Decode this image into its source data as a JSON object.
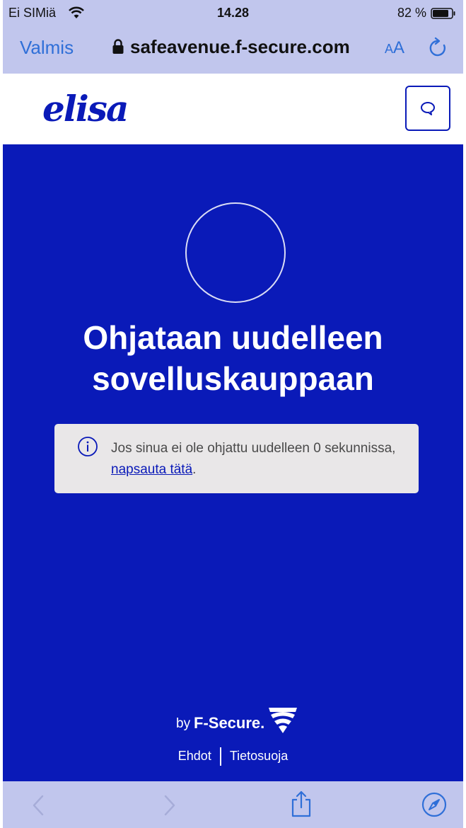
{
  "status_bar": {
    "carrier": "Ei SIMiä",
    "time": "14.28",
    "battery": "82 %"
  },
  "browser": {
    "done_label": "Valmis",
    "url": "safeavenue.f-secure.com",
    "text_size_small": "A",
    "text_size_big": "A"
  },
  "header": {
    "logo_text": "elisa"
  },
  "main": {
    "headline_line1": "Ohjataan uudelleen",
    "headline_line2": "sovelluskauppaan",
    "notice_text": "Jos sinua ei ole ohjattu uudelleen 0 sekunnissa, ",
    "notice_link": "napsauta tätä",
    "notice_end": "."
  },
  "footer": {
    "by": "by",
    "brand": "F-Secure.",
    "terms": "Ehdot",
    "privacy": "Tietosuoja"
  },
  "colors": {
    "brand_blue": "#0a1ab8",
    "safari_bar": "#c1c6ed",
    "link_blue": "#2f6fd8"
  }
}
